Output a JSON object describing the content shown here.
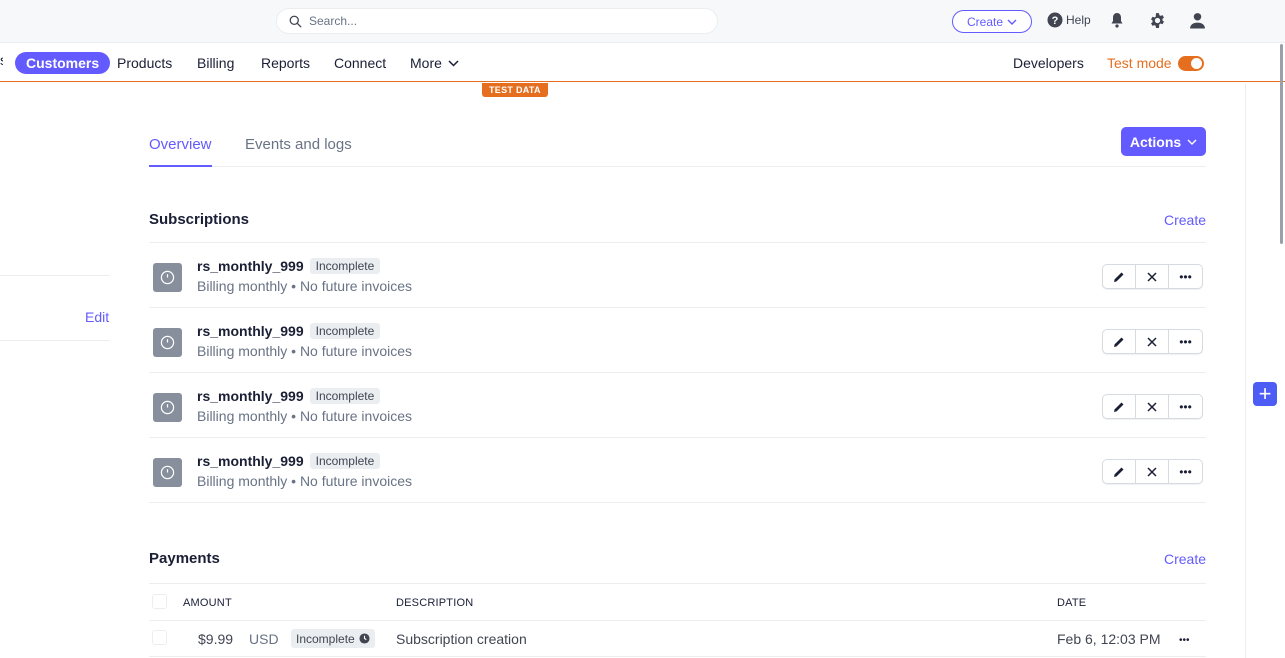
{
  "topbar": {
    "search_placeholder": "Search...",
    "create_label": "Create",
    "help_label": "Help",
    "icons": [
      "search-icon",
      "chevron-down-icon",
      "help-circle-icon",
      "bell-icon",
      "gear-icon",
      "user-icon"
    ]
  },
  "nav": {
    "truncated_item": "s",
    "items": [
      {
        "label": "Customers",
        "active": true
      },
      {
        "label": "Products"
      },
      {
        "label": "Billing"
      },
      {
        "label": "Reports"
      },
      {
        "label": "Connect"
      },
      {
        "label": "More"
      }
    ],
    "developers_label": "Developers",
    "test_mode_label": "Test mode",
    "test_mode_on": true,
    "test_data_badge": "TEST DATA"
  },
  "colors": {
    "accent": "#635bff",
    "test_mode": "#e56f1f",
    "text": "#1a1f36",
    "muted": "#687385"
  },
  "left_panel": {
    "edit_label": "Edit"
  },
  "tabs": [
    {
      "label": "Overview",
      "active": true
    },
    {
      "label": "Events and logs"
    }
  ],
  "actions_label": "Actions",
  "subscriptions": {
    "title": "Subscriptions",
    "create_label": "Create",
    "items": [
      {
        "name": "rs_monthly_999",
        "status": "Incomplete",
        "description": "Billing monthly • No future invoices"
      },
      {
        "name": "rs_monthly_999",
        "status": "Incomplete",
        "description": "Billing monthly • No future invoices"
      },
      {
        "name": "rs_monthly_999",
        "status": "Incomplete",
        "description": "Billing monthly • No future invoices"
      },
      {
        "name": "rs_monthly_999",
        "status": "Incomplete",
        "description": "Billing monthly • No future invoices"
      }
    ]
  },
  "payments": {
    "title": "Payments",
    "create_label": "Create",
    "columns": [
      "AMOUNT",
      "DESCRIPTION",
      "DATE"
    ],
    "rows": [
      {
        "amount": "$9.99",
        "currency": "USD",
        "status": "Incomplete",
        "description": "Subscription creation",
        "date": "Feb 6, 12:03 PM"
      }
    ]
  }
}
